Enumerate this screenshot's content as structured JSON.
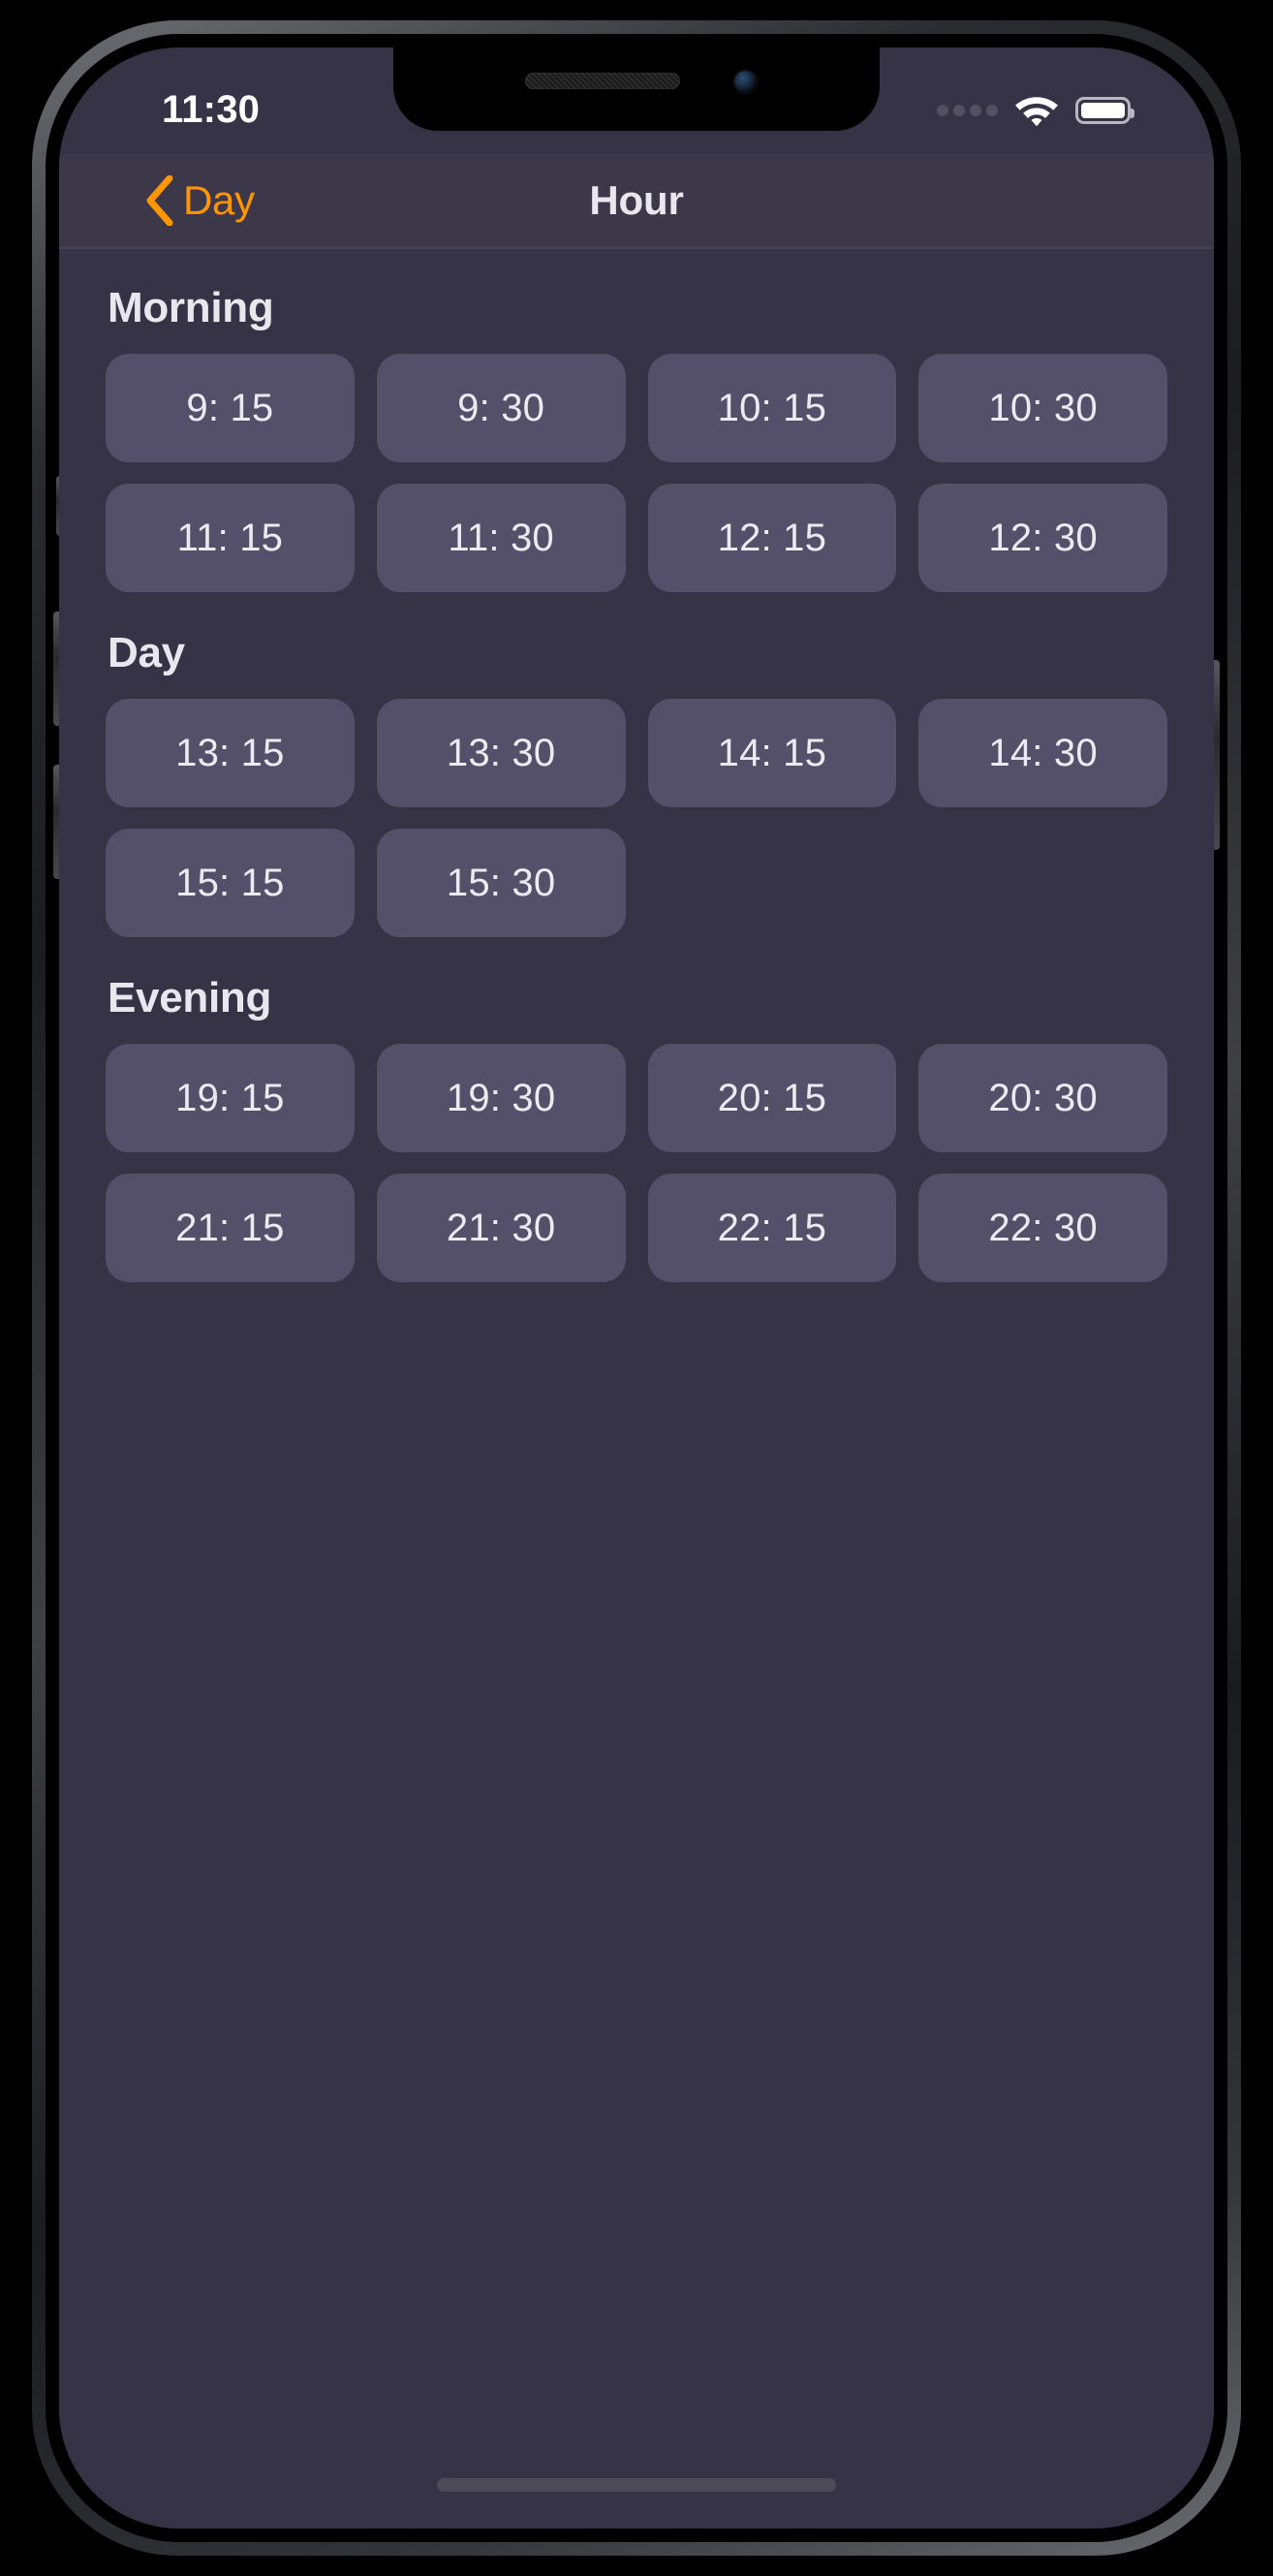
{
  "status_bar": {
    "time": "11:30",
    "cellular_icon": "cellular-dots-icon",
    "cellular_dots": 4,
    "wifi_icon": "wifi-icon",
    "battery_icon": "battery-full-icon",
    "battery_level_percent": 100
  },
  "nav_bar": {
    "back_icon": "chevron-left-icon",
    "back_label": "Day",
    "title": "Hour"
  },
  "colors": {
    "screen_background": "#373346",
    "nav_background": "#3c3849",
    "chip_background": "#55506a",
    "accent": "#ff9500",
    "primary_text": "#e9e7ee",
    "chip_text": "#eceaf1"
  },
  "sections": [
    {
      "title": "Morning",
      "slots": [
        "9: 15",
        "9: 30",
        "10: 15",
        "10: 30",
        "11: 15",
        "11: 30",
        "12: 15",
        "12: 30"
      ]
    },
    {
      "title": "Day",
      "slots": [
        "13: 15",
        "13: 30",
        "14: 15",
        "14: 30",
        "15: 15",
        "15: 30"
      ]
    },
    {
      "title": "Evening",
      "slots": [
        "19: 15",
        "19: 30",
        "20: 15",
        "20: 30",
        "21: 15",
        "21: 30",
        "22: 15",
        "22: 30"
      ]
    }
  ],
  "home_indicator": "home-indicator"
}
